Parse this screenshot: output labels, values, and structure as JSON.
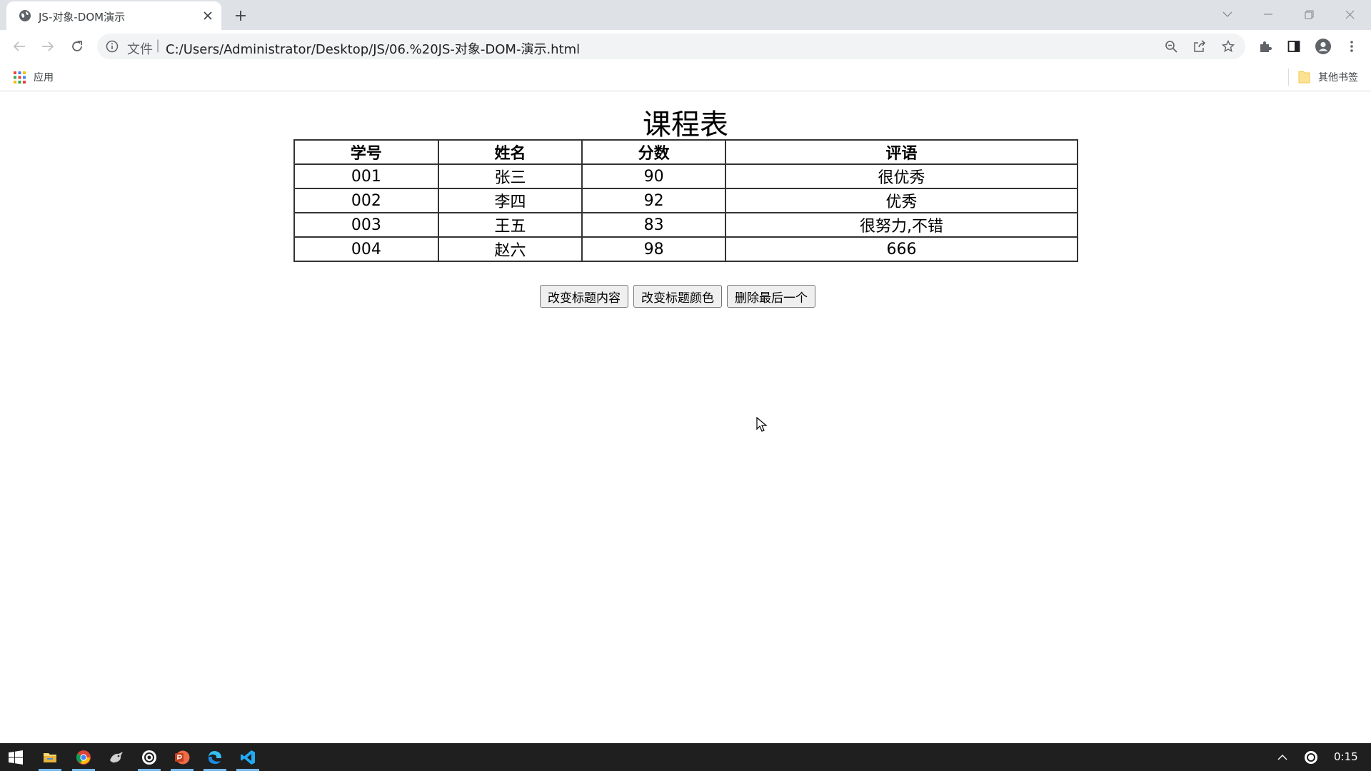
{
  "browser": {
    "tab": {
      "title": "JS-对象-DOM演示"
    },
    "address_bar": {
      "scheme_label": "文件",
      "separator": "|",
      "url": "C:/Users/Administrator/Desktop/JS/06.%20JS-对象-DOM-演示.html"
    },
    "bookmarks": {
      "apps_label": "应用",
      "other_label": "其他书签"
    }
  },
  "page": {
    "title": "课程表",
    "table": {
      "headers": [
        "学号",
        "姓名",
        "分数",
        "评语"
      ],
      "rows": [
        [
          "001",
          "张三",
          "90",
          "很优秀"
        ],
        [
          "002",
          "李四",
          "92",
          "优秀"
        ],
        [
          "003",
          "王五",
          "83",
          "很努力,不错"
        ],
        [
          "004",
          "赵六",
          "98",
          "666"
        ]
      ]
    },
    "buttons": {
      "change_title_content": "改变标题内容",
      "change_title_color": "改变标题颜色",
      "delete_last": "删除最后一个"
    }
  },
  "taskbar": {
    "clock": "0:15"
  },
  "colors": {
    "tabstrip_bg": "#dee1e6",
    "omnibox_bg": "#f1f3f4",
    "taskbar_bg": "#1f1f1f",
    "taskbar_active": "#76b9ed",
    "powerpoint": "#c43e1c",
    "vscode": "#0078d4"
  }
}
